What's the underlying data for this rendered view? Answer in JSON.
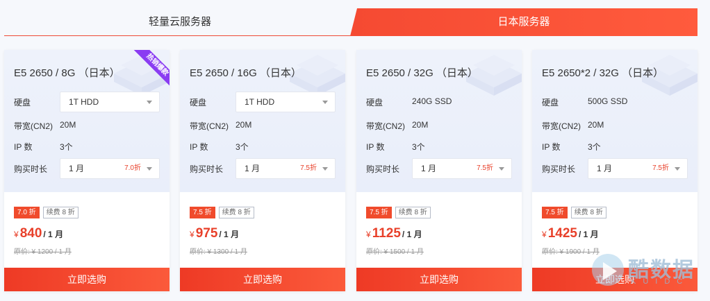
{
  "tabs": [
    {
      "label": "轻量云服务器",
      "active": false
    },
    {
      "label": "日本服务器",
      "active": true
    }
  ],
  "labels": {
    "disk": "硬盘",
    "bandwidth": "带宽(CN2)",
    "ip": "IP 数",
    "duration": "购买时长"
  },
  "cards": [
    {
      "title": "E5 2650 / 8G （日本）",
      "ribbon": "热销爆款",
      "disk": "1T HDD",
      "disk_is_select": true,
      "bandwidth": "20M",
      "ip": "3个",
      "duration": "1 月",
      "duration_discount": "7.0折",
      "badge_off": "7.0 折",
      "badge_renew": "续费 8 折",
      "yen": "¥",
      "price": "840",
      "unit": "/ 1 月",
      "original": "原价: ¥ 1200 / 1 月",
      "buy_label": "立即选购"
    },
    {
      "title": "E5 2650 / 16G （日本）",
      "disk": "1T HDD",
      "disk_is_select": true,
      "bandwidth": "20M",
      "ip": "3个",
      "duration": "1 月",
      "duration_discount": "7.5折",
      "badge_off": "7.5 折",
      "badge_renew": "续费 8 折",
      "yen": "¥",
      "price": "975",
      "unit": "/ 1 月",
      "original": "原价: ¥ 1300 / 1 月",
      "buy_label": "立即选购"
    },
    {
      "title": "E5 2650 / 32G （日本）",
      "disk": "240G SSD",
      "disk_is_select": false,
      "bandwidth": "20M",
      "ip": "3个",
      "duration": "1 月",
      "duration_discount": "7.5折",
      "badge_off": "7.5 折",
      "badge_renew": "续费 8 折",
      "yen": "¥",
      "price": "1125",
      "unit": "/ 1 月",
      "original": "原价: ¥ 1500 / 1 月",
      "buy_label": "立即选购"
    },
    {
      "title": "E5 2650*2 / 32G （日本）",
      "disk": "500G SSD",
      "disk_is_select": false,
      "bandwidth": "20M",
      "ip": "3个",
      "duration": "1 月",
      "duration_discount": "7.5折",
      "badge_off": "7.5 折",
      "badge_renew": "续费 8 折",
      "yen": "¥",
      "price": "1425",
      "unit": "/ 1 月",
      "original": "原价: ¥ 1900 / 1 月",
      "buy_label": "立即选购"
    }
  ],
  "watermark": {
    "text": "酷数据",
    "sub": "KUIDC"
  },
  "colors": {
    "accent": "#f04b2c",
    "ribbon": "#8a3cf2"
  }
}
